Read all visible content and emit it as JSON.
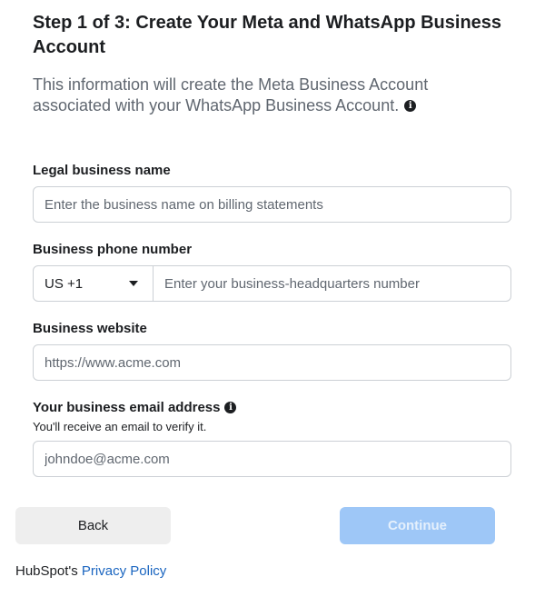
{
  "header": {
    "title": "Step 1 of 3: Create Your Meta and WhatsApp Business Account",
    "description": "This information will create the Meta Business Account associated with your WhatsApp Business Account."
  },
  "form": {
    "legal_name": {
      "label": "Legal business name",
      "placeholder": "Enter the business name on billing statements",
      "value": ""
    },
    "phone": {
      "label": "Business phone number",
      "country_code": "US +1",
      "placeholder": "Enter your business-headquarters number",
      "value": ""
    },
    "website": {
      "label": "Business website",
      "placeholder": "https://www.acme.com",
      "value": ""
    },
    "email": {
      "label": "Your business email address",
      "helper": "You'll receive an email to verify it.",
      "placeholder": "johndoe@acme.com",
      "value": ""
    }
  },
  "actions": {
    "back_label": "Back",
    "continue_label": "Continue",
    "continue_disabled": true
  },
  "footer": {
    "prefix": "HubSpot's",
    "link_label": "Privacy Policy"
  },
  "icons": {
    "info": "info-icon",
    "dropdown": "chevron-down-icon"
  },
  "colors": {
    "primary_disabled": "#9ec7f7",
    "link": "#1a65c0",
    "muted_text": "#606770"
  }
}
